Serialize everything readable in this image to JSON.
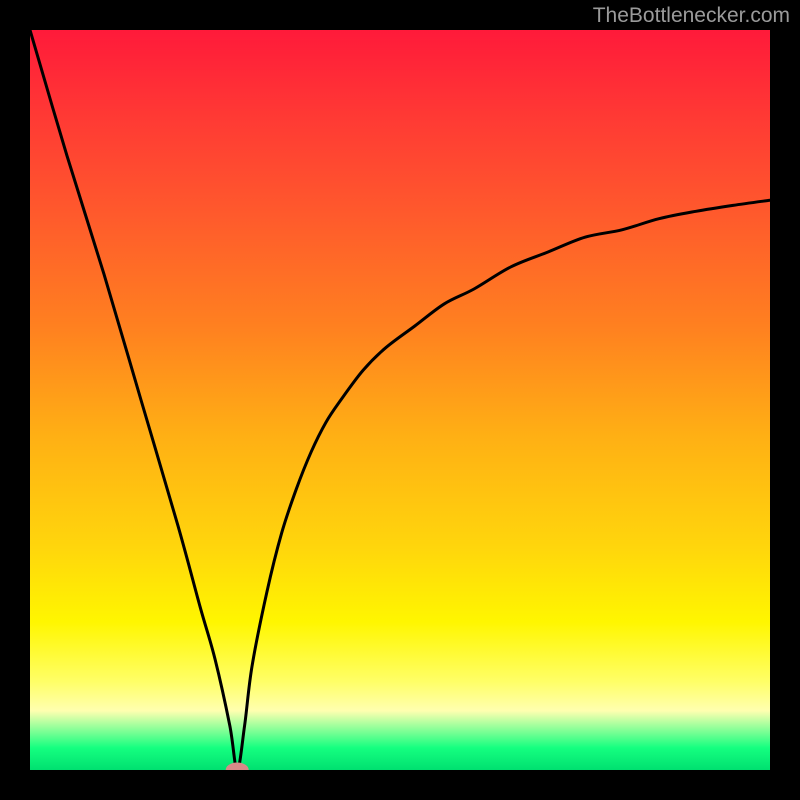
{
  "watermark": {
    "text": "TheBottlenecker.com"
  },
  "chart_data": {
    "type": "line",
    "title": "",
    "xlabel": "",
    "ylabel": "",
    "xlim": [
      0,
      100
    ],
    "ylim": [
      0,
      100
    ],
    "grid": false,
    "legend_position": "none",
    "gradient_colors": {
      "top": "#ff1a3a",
      "mid_upper": "#ff8020",
      "mid_lower": "#ffd60c",
      "bottom_accent": "#fff600",
      "bottom": "#00e070"
    },
    "marker": {
      "label": "optimal-point",
      "x": 28,
      "y": 0,
      "color": "#d88a88"
    },
    "series": [
      {
        "name": "bottleneck-curve",
        "x": [
          0,
          5,
          10,
          15,
          20,
          23,
          25,
          27,
          28,
          29,
          30,
          32,
          34,
          36,
          38,
          40,
          42,
          45,
          48,
          52,
          56,
          60,
          65,
          70,
          75,
          80,
          85,
          90,
          95,
          100
        ],
        "values": [
          100,
          83,
          67,
          50,
          33,
          22,
          15,
          6,
          0,
          6,
          14,
          24,
          32,
          38,
          43,
          47,
          50,
          54,
          57,
          60,
          63,
          65,
          68,
          70,
          72,
          73,
          74.5,
          75.5,
          76.3,
          77
        ]
      }
    ]
  }
}
